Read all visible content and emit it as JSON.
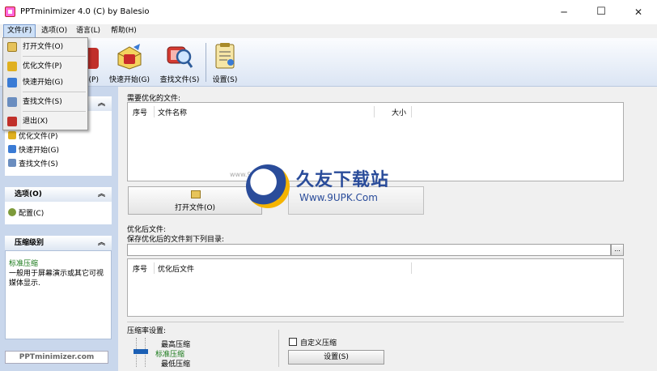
{
  "window": {
    "title": "PPTminimizer 4.0 (C) by Balesio",
    "minimize_glyph": "─",
    "maximize_glyph": "☐",
    "close_glyph": "✕"
  },
  "menu": {
    "file": "文件(F)",
    "options": "选项(O)",
    "language": "语言(L)",
    "help": "帮助(H)"
  },
  "file_menu_items": [
    "打开文件(O)",
    "优化文件(P)",
    "快速开始(G)",
    "查找文件(S)",
    "退出(X)"
  ],
  "toolbar": {
    "partial_label": "件(P)",
    "quickstart": "快速开始(G)",
    "find_files": "查找文件(S)",
    "settings": "设置(S)"
  },
  "left_panel": {
    "tasks": [
      "优化文件(P)",
      "快速开始(G)",
      "查找文件(S)"
    ],
    "options_title": "选项(O)",
    "options_items": [
      "配置(C)"
    ],
    "compression_title": "压缩级别",
    "compression_level": "标准压缩",
    "compression_desc": "一般用于屏幕演示或其它可视媒体显示.",
    "logo_text": "PPTminimizer.com"
  },
  "main": {
    "files_to_optimize_label": "需要优化的文件:",
    "input_columns": [
      "序号",
      "文件名称",
      "大小"
    ],
    "open_file_button": "打开文件(O)",
    "optimized_files_label": "优化后文件:",
    "save_to_dir_label": "保存优化后的文件到下列目录:",
    "output_dir_value": "",
    "browse_button": "...",
    "output_columns": [
      "序号",
      "优化后文件"
    ],
    "compression_settings_label": "压缩率设置:",
    "levels": [
      "最高压缩",
      "标准压缩",
      "最低压缩"
    ],
    "custom_compression_label": "自定义压缩",
    "custom_compression_checked": false,
    "settings_button": "设置(S)"
  },
  "watermark": {
    "name": "久友下载站",
    "url": "Www.9UPK.Com",
    "small_url": "www.9UPK.com"
  },
  "colors": {
    "left_panel_bg": "#c9d7ec",
    "toolbar_gradient_bottom": "#dbe5f4",
    "compression_level_text": "#1a7a1a",
    "watermark_blue": "#2a4c9a",
    "watermark_gold": "#f5b400"
  }
}
